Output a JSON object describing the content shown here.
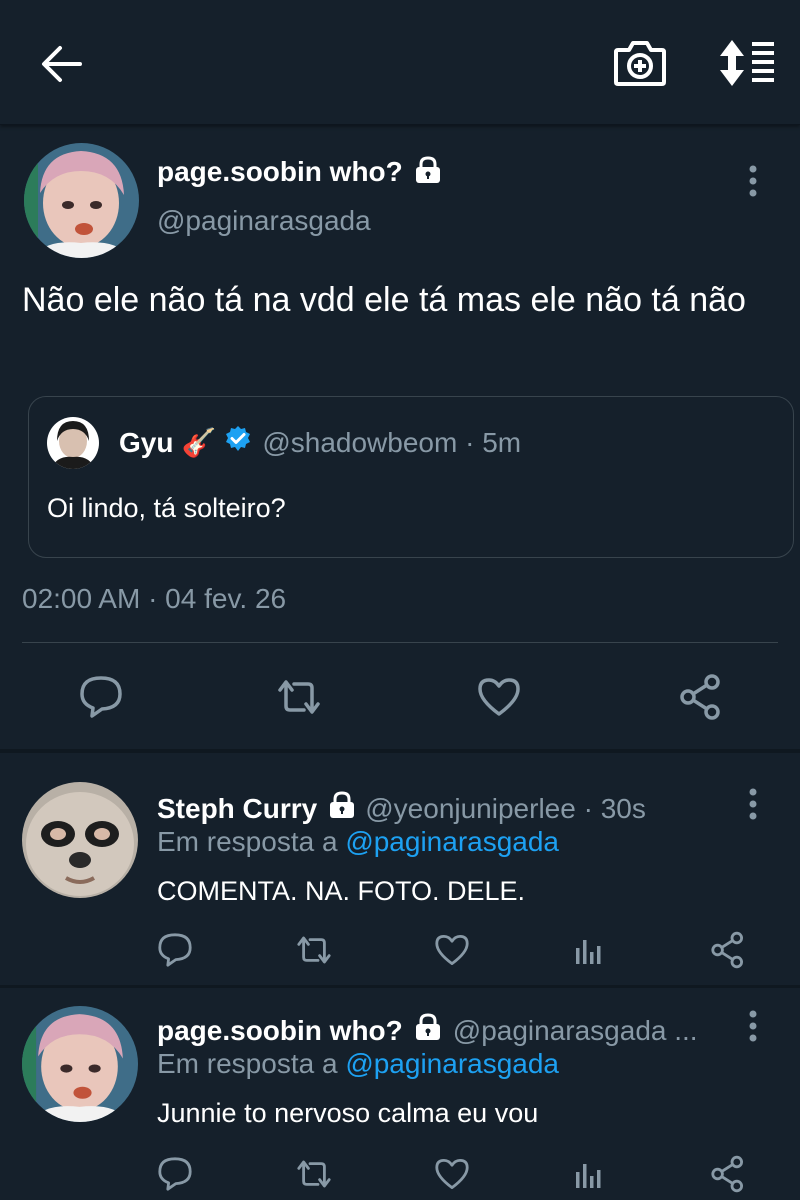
{
  "main_tweet": {
    "name": "page.soobin who?",
    "handle": "@paginarasgada",
    "text": "Não ele não tá na vdd ele tá mas ele não tá não",
    "timestamp": "02:00 AM · 04 fev. 26"
  },
  "quoted_tweet": {
    "name": "Gyu",
    "emoji": "🎸",
    "handle_time": "@shadowbeom · 5m",
    "text": "Oi lindo, tá solteiro?"
  },
  "replies": [
    {
      "name": "Steph Curry",
      "handle_time": "@yeonjuniperlee · 30s",
      "reply_prefix": "Em resposta a",
      "reply_to": "@paginarasgada",
      "text": "COMENTA. NA. FOTO. DELE."
    },
    {
      "name": "page.soobin who?",
      "handle_time": "@paginarasgada ...",
      "reply_prefix": "Em resposta a",
      "reply_to": "@paginarasgada",
      "text": "Junnie to nervoso calma eu vou"
    }
  ],
  "icons": [
    "back-arrow-icon",
    "camera-plus-icon",
    "sort-icon",
    "lock-icon",
    "verified-icon",
    "more-vertical-icon",
    "reply-icon",
    "retweet-icon",
    "like-icon",
    "share-icon",
    "analytics-icon"
  ],
  "colors": {
    "background": "#15202b",
    "text": "#ffffff",
    "muted": "#8899a6",
    "link": "#1da1f2",
    "border": "#38444d"
  }
}
